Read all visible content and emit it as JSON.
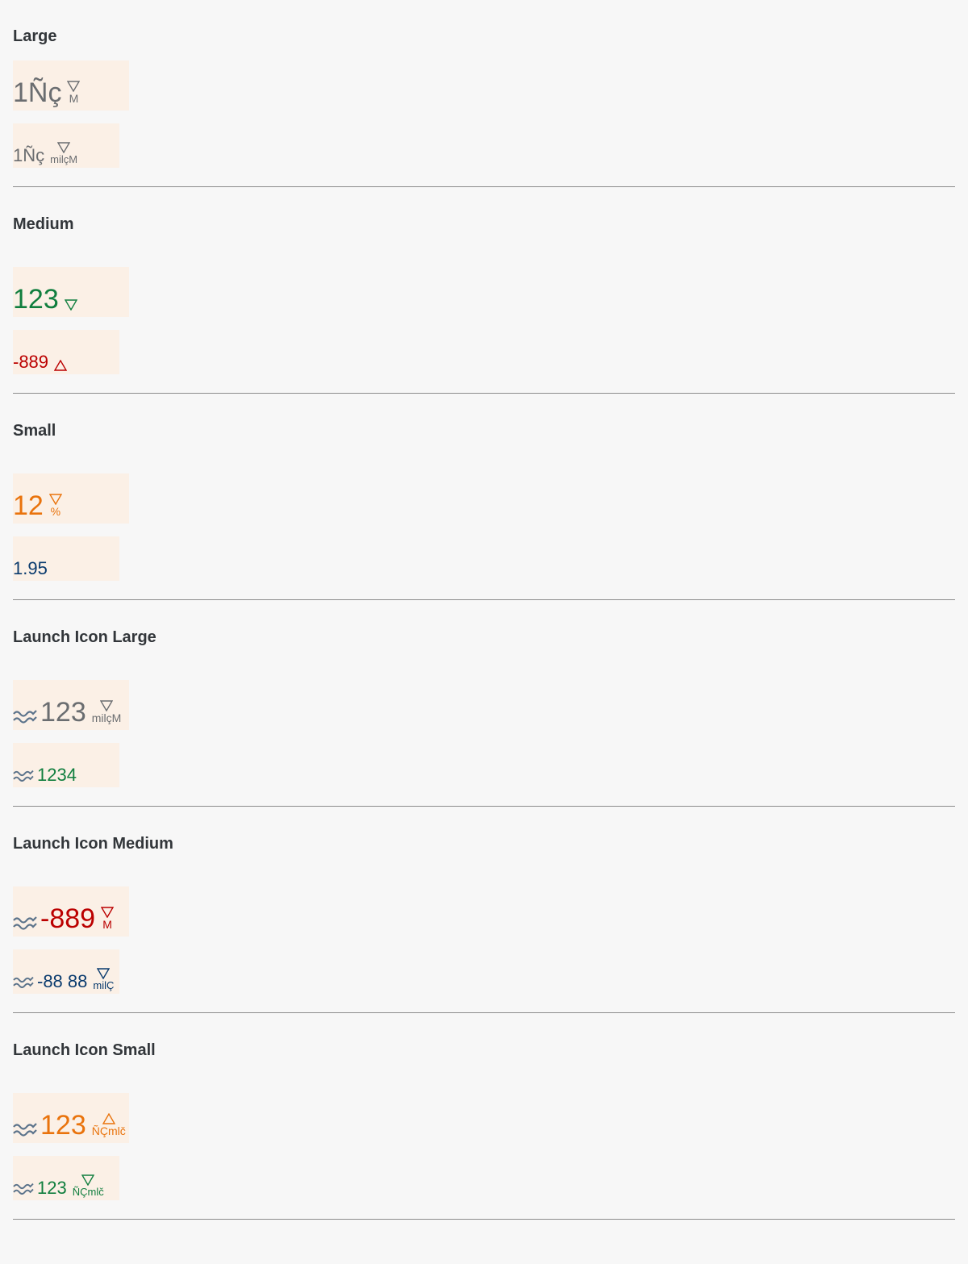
{
  "colors": {
    "neutral": "#6a6d70",
    "good": "#107e3e",
    "error": "#bb0000",
    "critical": "#e9730c",
    "info": "#0a3b6e",
    "icon": "#5b738b"
  },
  "sections": [
    {
      "title": "Large",
      "tile1": {
        "value": "1Ñç",
        "unit": "M",
        "arrow": "down",
        "state": "neutral",
        "icon": false
      },
      "tile2": {
        "value": "1Ñç",
        "unit": "milçM",
        "arrow": "down",
        "state": "neutral",
        "icon": false
      }
    },
    {
      "title": "Medium",
      "tile1": {
        "value": "123",
        "unit": "",
        "arrow": "down",
        "state": "good",
        "icon": false
      },
      "tile2": {
        "value": "-889",
        "unit": "",
        "arrow": "up",
        "state": "error",
        "icon": false
      }
    },
    {
      "title": "Small",
      "tile1": {
        "value": "12",
        "unit": "%",
        "arrow": "down",
        "state": "critical",
        "icon": false
      },
      "tile2": {
        "value": "1.95",
        "unit": "",
        "arrow": "",
        "state": "info",
        "icon": false
      }
    },
    {
      "title": "Launch Icon Large",
      "tile1": {
        "value": "123",
        "unit": "milçM",
        "arrow": "down",
        "state": "neutral",
        "icon": true
      },
      "tile2": {
        "value": "1234",
        "unit": "",
        "arrow": "",
        "state": "good",
        "icon": true
      }
    },
    {
      "title": "Launch Icon Medium",
      "tile1": {
        "value": "-889",
        "unit": "M",
        "arrow": "down",
        "state": "error",
        "icon": true
      },
      "tile2": {
        "value": "-88 88",
        "unit": "milÇ",
        "arrow": "down",
        "state": "info",
        "icon": true
      }
    },
    {
      "title": "Launch Icon Small",
      "tile1": {
        "value": "123",
        "unit": "ÑÇmlč",
        "arrow": "up",
        "state": "critical",
        "icon": true
      },
      "tile2": {
        "value": "123",
        "unit": "ÑÇmlč",
        "arrow": "down",
        "state": "good",
        "icon": true
      }
    }
  ]
}
